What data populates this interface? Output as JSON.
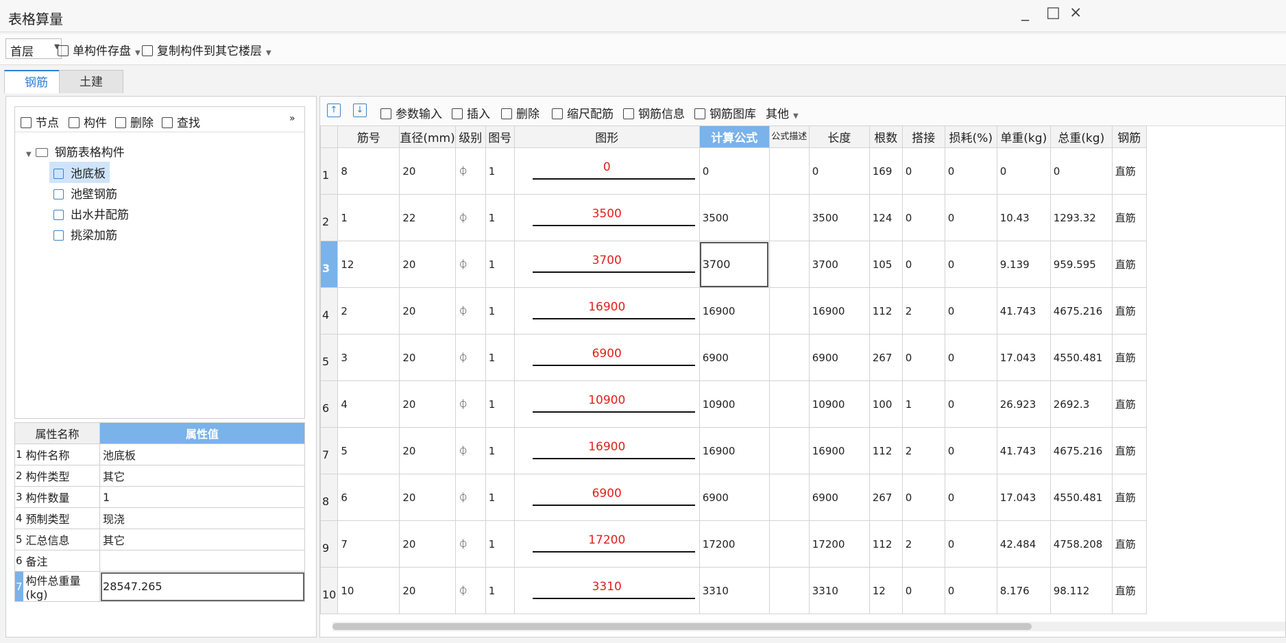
{
  "window": {
    "title": "表格算量",
    "minimize": "_",
    "maximize": "□",
    "close": "×"
  },
  "toolbar": {
    "floor_select": "首层",
    "save_single": "单构件存盘",
    "copy_to_floors": "复制构件到其它楼层"
  },
  "tabs": [
    {
      "label": "钢筋"
    },
    {
      "label": "土建"
    }
  ],
  "tree": {
    "toolbar": {
      "node": "节点",
      "component": "构件",
      "delete": "删除",
      "find": "查找",
      "more": "»"
    },
    "root": "钢筋表格构件",
    "items": [
      "池底板",
      "池壁钢筋",
      "出水井配筋",
      "挑梁加筋"
    ],
    "selected": "池底板"
  },
  "properties": {
    "headers": {
      "name": "属性名称",
      "value": "属性值"
    },
    "rows": [
      {
        "n": "1",
        "name": "构件名称",
        "value": "池底板"
      },
      {
        "n": "2",
        "name": "构件类型",
        "value": "其它"
      },
      {
        "n": "3",
        "name": "构件数量",
        "value": "1"
      },
      {
        "n": "4",
        "name": "预制类型",
        "value": "现浇"
      },
      {
        "n": "5",
        "name": "汇总信息",
        "value": "其它"
      },
      {
        "n": "6",
        "name": "备注",
        "value": ""
      },
      {
        "n": "7",
        "name": "构件总重量(kg)",
        "value": "28547.265"
      }
    ]
  },
  "grid_toolbar": {
    "move_up": "↑",
    "move_down": "↓",
    "param_input": "参数输入",
    "insert": "插入",
    "delete": "删除",
    "scale_rebar": "缩尺配筋",
    "rebar_info": "钢筋信息",
    "rebar_library": "钢筋图库",
    "other": "其他"
  },
  "grid": {
    "headers": {
      "bar_no": "筋号",
      "diameter": "直径(mm)",
      "grade": "级别",
      "fig_no": "图号",
      "shape": "图形",
      "formula": "计算公式",
      "formula_desc": "公式描述",
      "length": "长度",
      "count": "根数",
      "lap": "搭接",
      "loss": "损耗(%)",
      "unit_weight": "单重(kg)",
      "total_weight": "总重(kg)",
      "type": "钢筋"
    },
    "rows": [
      {
        "n": "1",
        "bar_no": "8",
        "diameter": "20",
        "grade": "⏀",
        "fig_no": "1",
        "shape": "0",
        "formula": "0",
        "length": "0",
        "count": "169",
        "lap": "0",
        "loss": "0",
        "unit_weight": "0",
        "total_weight": "0",
        "type": "直筋"
      },
      {
        "n": "2",
        "bar_no": "1",
        "diameter": "22",
        "grade": "⏀",
        "fig_no": "1",
        "shape": "3500",
        "formula": "3500",
        "length": "3500",
        "count": "124",
        "lap": "0",
        "loss": "0",
        "unit_weight": "10.43",
        "total_weight": "1293.32",
        "type": "直筋"
      },
      {
        "n": "3",
        "bar_no": "12",
        "diameter": "20",
        "grade": "⏀",
        "fig_no": "1",
        "shape": "3700",
        "formula": "3700",
        "length": "3700",
        "count": "105",
        "lap": "0",
        "loss": "0",
        "unit_weight": "9.139",
        "total_weight": "959.595",
        "type": "直筋"
      },
      {
        "n": "4",
        "bar_no": "2",
        "diameter": "20",
        "grade": "⏀",
        "fig_no": "1",
        "shape": "16900",
        "formula": "16900",
        "length": "16900",
        "count": "112",
        "lap": "2",
        "loss": "0",
        "unit_weight": "41.743",
        "total_weight": "4675.216",
        "type": "直筋"
      },
      {
        "n": "5",
        "bar_no": "3",
        "diameter": "20",
        "grade": "⏀",
        "fig_no": "1",
        "shape": "6900",
        "formula": "6900",
        "length": "6900",
        "count": "267",
        "lap": "0",
        "loss": "0",
        "unit_weight": "17.043",
        "total_weight": "4550.481",
        "type": "直筋"
      },
      {
        "n": "6",
        "bar_no": "4",
        "diameter": "20",
        "grade": "⏀",
        "fig_no": "1",
        "shape": "10900",
        "formula": "10900",
        "length": "10900",
        "count": "100",
        "lap": "1",
        "loss": "0",
        "unit_weight": "26.923",
        "total_weight": "2692.3",
        "type": "直筋"
      },
      {
        "n": "7",
        "bar_no": "5",
        "diameter": "20",
        "grade": "⏀",
        "fig_no": "1",
        "shape": "16900",
        "formula": "16900",
        "length": "16900",
        "count": "112",
        "lap": "2",
        "loss": "0",
        "unit_weight": "41.743",
        "total_weight": "4675.216",
        "type": "直筋"
      },
      {
        "n": "8",
        "bar_no": "6",
        "diameter": "20",
        "grade": "⏀",
        "fig_no": "1",
        "shape": "6900",
        "formula": "6900",
        "length": "6900",
        "count": "267",
        "lap": "0",
        "loss": "0",
        "unit_weight": "17.043",
        "total_weight": "4550.481",
        "type": "直筋"
      },
      {
        "n": "9",
        "bar_no": "7",
        "diameter": "20",
        "grade": "⏀",
        "fig_no": "1",
        "shape": "17200",
        "formula": "17200",
        "length": "17200",
        "count": "112",
        "lap": "2",
        "loss": "0",
        "unit_weight": "42.484",
        "total_weight": "4758.208",
        "type": "直筋"
      },
      {
        "n": "10",
        "bar_no": "10",
        "diameter": "20",
        "grade": "⏀",
        "fig_no": "1",
        "shape": "3310",
        "formula": "3310",
        "length": "3310",
        "count": "12",
        "lap": "0",
        "loss": "0",
        "unit_weight": "8.176",
        "total_weight": "98.112",
        "type": "直筋"
      }
    ]
  },
  "colors": {
    "accent": "#2b7fd6",
    "header_highlight": "#7ab2ea",
    "shape_text": "#e0201c"
  }
}
